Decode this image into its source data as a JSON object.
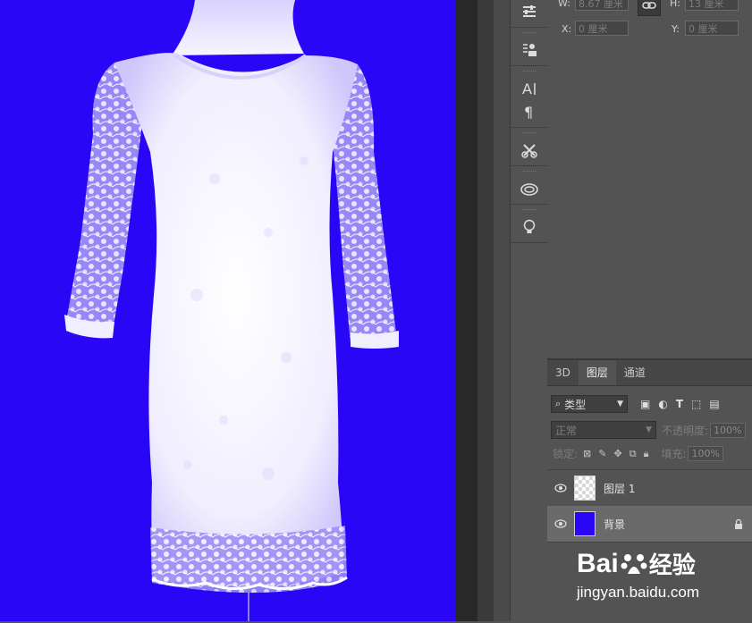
{
  "toolstrip": {
    "icons": [
      "adjust-sliders-icon",
      "clone-source-icon",
      "character-icon",
      "paragraph-icon",
      "tool-presets-icon",
      "creative-cloud-icon",
      "learn-lightbulb-icon"
    ]
  },
  "properties": {
    "w_label": "W:",
    "w_value": "8.67 厘米",
    "h_label": "H:",
    "h_value": "13 厘米",
    "x_label": "X:",
    "x_value": "0 厘米",
    "y_label": "Y:",
    "y_value": "0 厘米"
  },
  "layers_panel": {
    "tabs": [
      {
        "label": "3D",
        "active": false
      },
      {
        "label": "图层",
        "active": true
      },
      {
        "label": "通道",
        "active": false
      }
    ],
    "filter_kind": "类型",
    "blend_mode": "正常",
    "opacity_label": "不透明度:",
    "opacity_value": "100%",
    "lock_label": "锁定:",
    "fill_label": "填充:",
    "fill_value": "100%",
    "layers": [
      {
        "name": "图层 1",
        "thumb": "transparent",
        "selected": false,
        "locked": false
      },
      {
        "name": "背景",
        "thumb": "#2a06f6",
        "selected": true,
        "locked": true
      }
    ]
  },
  "watermark": {
    "brand": "Bai",
    "brand_suffix": "经验",
    "url": "jingyan.baidu.com"
  },
  "colors": {
    "canvas_bg": "#2a06f6",
    "panel_bg": "#535353",
    "selected_layer": "#6a6a6a"
  }
}
